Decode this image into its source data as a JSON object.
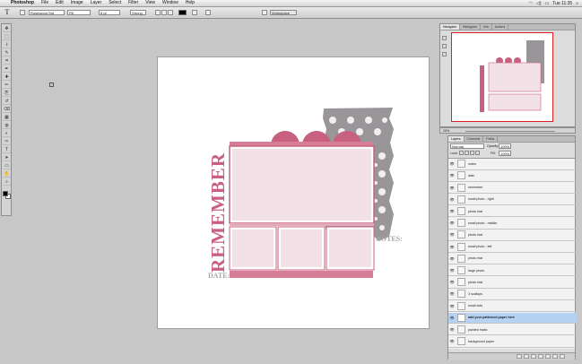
{
  "menubar": {
    "app_name": "Photoshop",
    "items": [
      "File",
      "Edit",
      "Image",
      "Layer",
      "Select",
      "Filter",
      "View",
      "Window",
      "Help"
    ],
    "clock": "Tue 11:35"
  },
  "options": {
    "tool_glyph": "T",
    "font_family": "Rosewood Std",
    "font_style": "Fill",
    "font_size": "8 pt",
    "antialias": "Strong",
    "workspace": "Workspace"
  },
  "navigator": {
    "tabs": [
      "Navigator",
      "Histogram",
      "Info",
      "Actions"
    ],
    "zoom": "25%"
  },
  "layers_panel": {
    "tabs": [
      "Layers",
      "Channels",
      "Paths"
    ],
    "blend_mode": "Normal",
    "opacity_label": "Opacity:",
    "opacity": "100%",
    "lock_label": "Lock:",
    "fill_label": "Fill:",
    "fill": "100%",
    "layers": [
      {
        "name": "notes",
        "selected": false
      },
      {
        "name": "date",
        "selected": false
      },
      {
        "name": "remember",
        "selected": false
      },
      {
        "name": "small photo - right",
        "selected": false
      },
      {
        "name": "photo mat",
        "selected": false
      },
      {
        "name": "small photo - middle",
        "selected": false
      },
      {
        "name": "photo mat",
        "selected": false
      },
      {
        "name": "small photo - left",
        "selected": false
      },
      {
        "name": "photo mat",
        "selected": false
      },
      {
        "name": "large photo",
        "selected": false
      },
      {
        "name": "photo mat",
        "selected": false
      },
      {
        "name": "3 scallops",
        "selected": false
      },
      {
        "name": "small dots",
        "selected": false
      },
      {
        "name": "add your patterned paper here",
        "selected": true
      },
      {
        "name": "painted mask",
        "selected": false
      },
      {
        "name": "background paper",
        "selected": false
      }
    ]
  },
  "canvas": {
    "title_text": "REMEMBER",
    "date_label": "DATE:",
    "notes_label": "NOTES:"
  },
  "colors": {
    "accent_pink": "#c8607f",
    "photo_pink": "#f2e1e7",
    "pattern_gray": "#9a9598"
  },
  "tools": [
    "move-tool",
    "marquee-tool",
    "lasso-tool",
    "quick-select-tool",
    "crop-tool",
    "eyedropper-tool",
    "healing-tool",
    "brush-tool",
    "stamp-tool",
    "history-brush-tool",
    "eraser-tool",
    "gradient-tool",
    "blur-tool",
    "dodge-tool",
    "pen-tool",
    "type-tool",
    "path-select-tool",
    "shape-tool",
    "hand-tool",
    "zoom-tool"
  ]
}
